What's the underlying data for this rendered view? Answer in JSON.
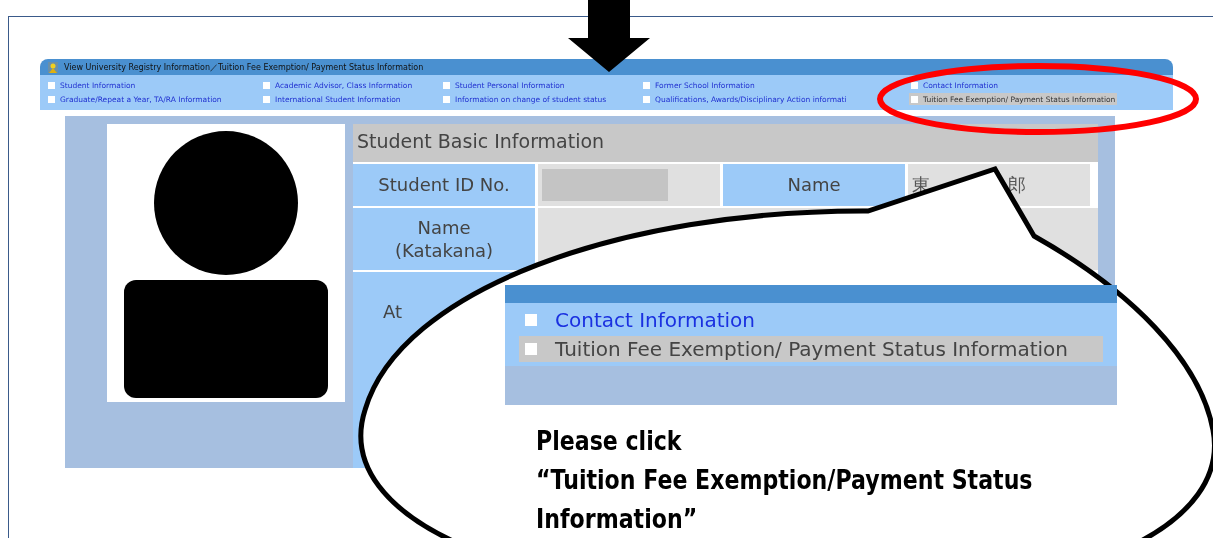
{
  "window": {
    "title": "View University Registry Information／Tuition Fee Exemption/ Payment Status Information"
  },
  "tabs": [
    {
      "label": "Student Information",
      "selected": false
    },
    {
      "label": "Academic Advisor, Class Information",
      "selected": false
    },
    {
      "label": "Student Personal Information",
      "selected": false
    },
    {
      "label": "Former School Information",
      "selected": false
    },
    {
      "label": "Contact Information",
      "selected": false
    },
    {
      "label": "Graduate/Repeat a Year, TA/RA Information",
      "selected": false
    },
    {
      "label": "International Student Information",
      "selected": false
    },
    {
      "label": "Information on change of student status",
      "selected": false
    },
    {
      "label": "Qualifications,  Awards/Disciplinary Action informati",
      "selected": false
    },
    {
      "label": "Tuition Fee Exemption/ Payment Status Information",
      "selected": true
    }
  ],
  "basic_info": {
    "title": "Student Basic Information",
    "student_id_label": "Student ID No.",
    "name_label": "Name",
    "name_value_start": "東",
    "name_value_end": "郎",
    "katakana_label": "Name\n(Katakana)",
    "third_label": "At"
  },
  "callout": {
    "tabs": [
      {
        "label": "Contact Information",
        "selected": false
      },
      {
        "label": "Tuition Fee Exemption/ Payment Status Information",
        "selected": true
      }
    ],
    "lines": [
      "Please click",
      "“Tuition Fee Exemption/Payment Status",
      "Information”"
    ]
  }
}
